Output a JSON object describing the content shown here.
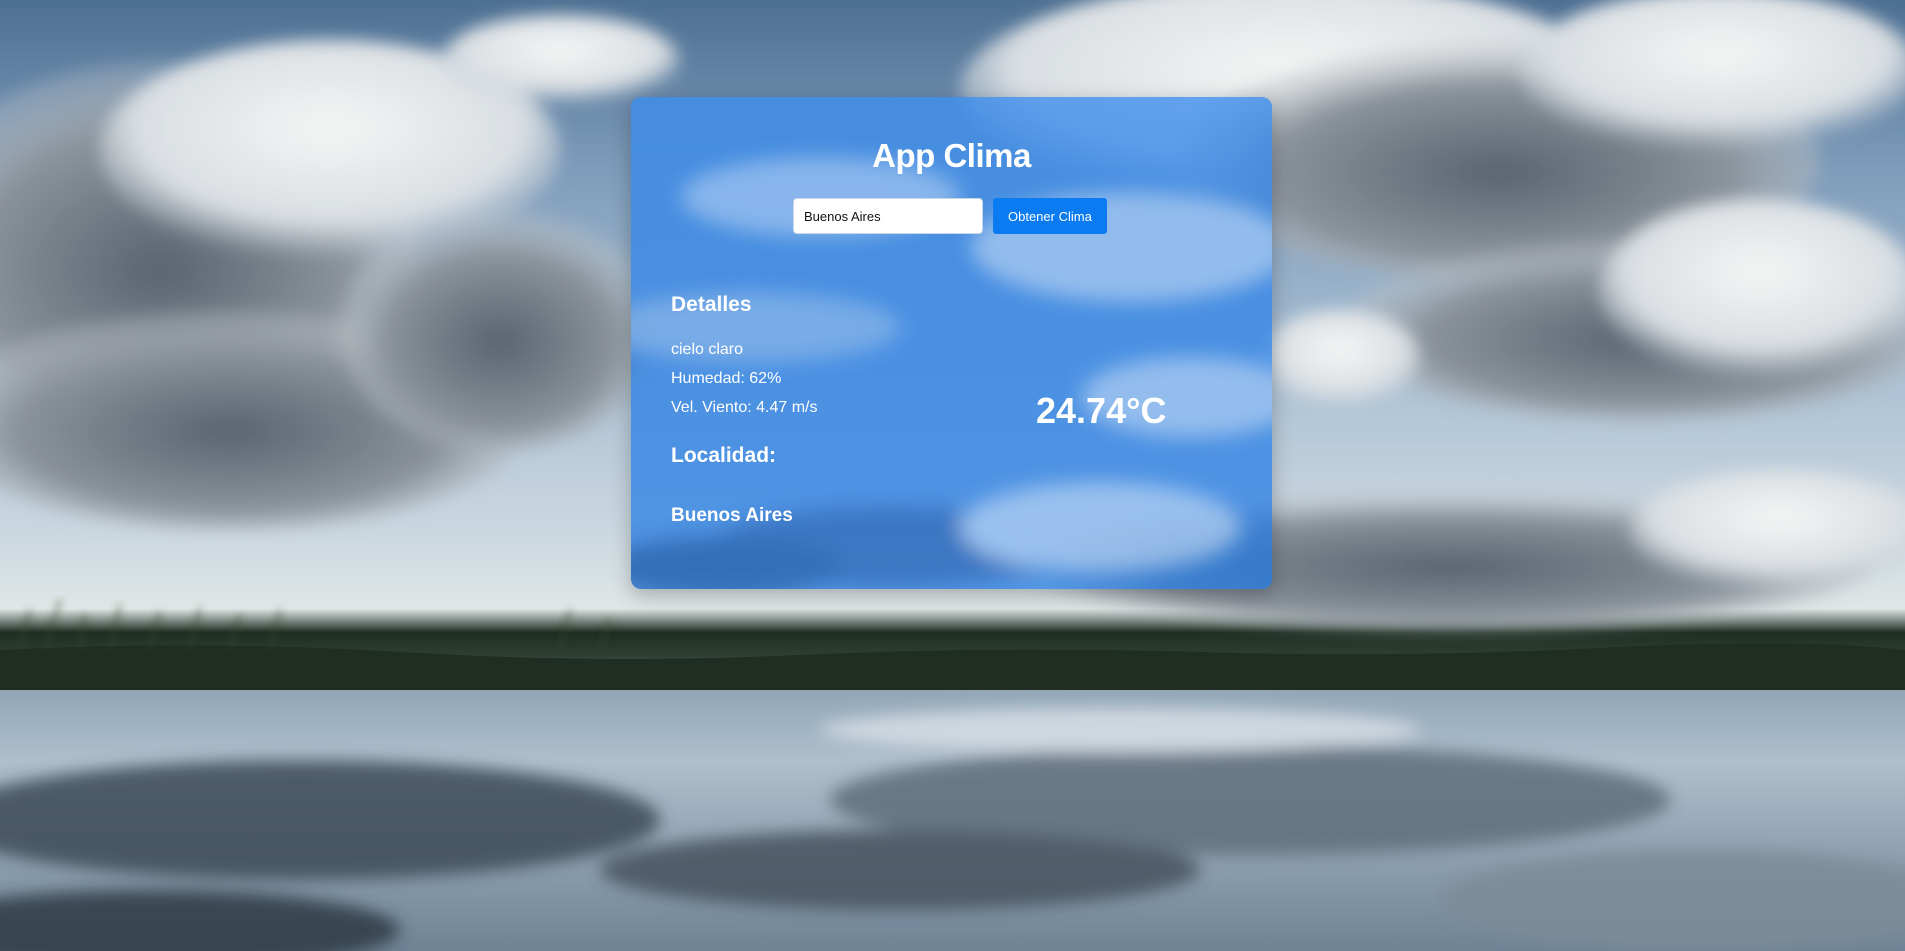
{
  "app": {
    "title": "App Clima"
  },
  "search": {
    "value": "Buenos Aires",
    "button_label": "Obtener Clima"
  },
  "details": {
    "heading": "Detalles",
    "description": "cielo claro",
    "humidity": "Humedad: 62%",
    "wind": "Vel. Viento: 4.47 m/s"
  },
  "temperature": "24.74°C",
  "location": {
    "heading": "Localidad:",
    "name": "Buenos Aires"
  },
  "colors": {
    "card": "#1676eb",
    "button": "#0a7bf0",
    "text": "#ffffff"
  }
}
